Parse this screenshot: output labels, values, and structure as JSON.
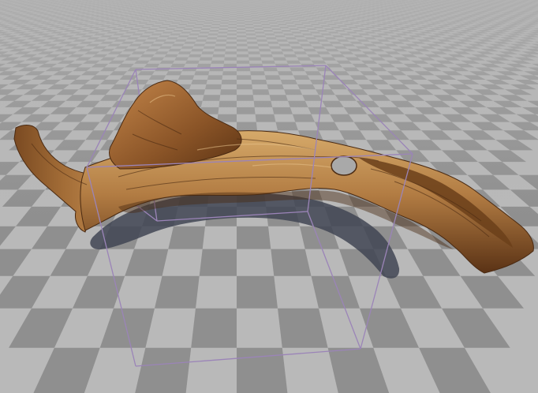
{
  "viewport": {
    "object": "driftwood-log-mesh",
    "floor": "checker-grid",
    "colors": {
      "checker_light": "#b9b9b9",
      "checker_dark": "#8f8f8f",
      "bounds": "#9b84b8",
      "wood_light": "#c89a5c",
      "wood_mid": "#9a6733",
      "wood_dark": "#4a2a12",
      "shadow": "#3d4250"
    }
  }
}
